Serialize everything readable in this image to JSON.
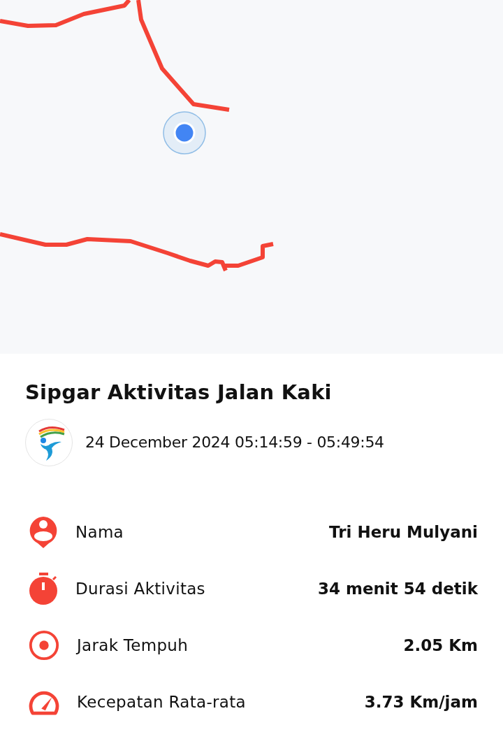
{
  "map": {
    "kind": "route-map"
  },
  "activity": {
    "title": "Sipgar Aktivitas Jalan Kaki",
    "datetime": "24 December 2024 05:14:59 - 05:49:54"
  },
  "stats": [
    {
      "kind": "person",
      "label": "Nama",
      "value": "Tri Heru Mulyani"
    },
    {
      "kind": "timer",
      "label": "Durasi Aktivitas",
      "value": "34 menit 54 detik"
    },
    {
      "kind": "distance",
      "label": "Jarak Tempuh",
      "value": "2.05 Km"
    },
    {
      "kind": "speed",
      "label": "Kecepatan Rata-rata",
      "value": "3.73 Km/jam"
    }
  ]
}
